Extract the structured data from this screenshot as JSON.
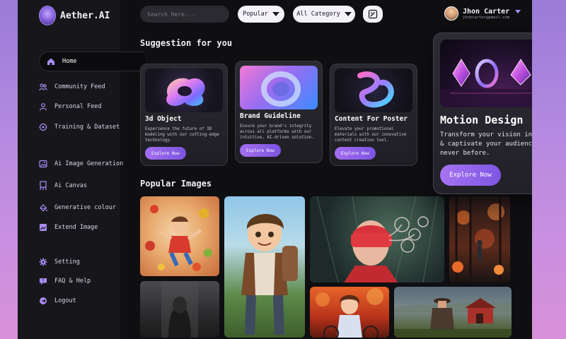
{
  "app": {
    "name": "Aether.AI"
  },
  "search": {
    "placeholder": "Search Here..."
  },
  "filters": {
    "popular_label": "Popular",
    "category_label": "All Category"
  },
  "user": {
    "name": "Jhon Carter",
    "email": "jhoncarter@gmail.com"
  },
  "sidebar": {
    "items": [
      {
        "label": "Home",
        "icon": "home-icon",
        "active": true
      },
      {
        "label": "Community Feed",
        "icon": "users-icon"
      },
      {
        "label": "Personal Feed",
        "icon": "user-icon"
      },
      {
        "label": "Training & Dataset",
        "icon": "training-icon"
      },
      {
        "label": "Ai Image Generation",
        "icon": "image-generation-icon"
      },
      {
        "label": "Ai Canvas",
        "icon": "canvas-icon"
      },
      {
        "label": "Generative colour",
        "icon": "palette-icon"
      },
      {
        "label": "Extend Image",
        "icon": "extend-image-icon"
      },
      {
        "label": "Setting",
        "icon": "gear-icon"
      },
      {
        "label": "FAQ & Help",
        "icon": "help-icon"
      },
      {
        "label": "Logout",
        "icon": "logout-icon"
      }
    ]
  },
  "suggestions": {
    "title": "Suggestion for you",
    "cards": [
      {
        "title": "3d Object",
        "desc": "Experience the future of 3D modeling with our cutting-edge technology.",
        "button": "Explore Now"
      },
      {
        "title": "Brand Guideline",
        "desc": "Ensure your brand's integrity across all platforms with our intuitive, AI-driven solution.",
        "button": "Explore Now"
      },
      {
        "title": "Content For Poster",
        "desc": "Elevate your promotional materials with our innovative content creation tool.",
        "button": "Explore Now"
      }
    ],
    "featured": {
      "title": "Motion Design",
      "desc": "Transform your vision into motion & captivate your audience like never before.",
      "button": "Explore Now"
    }
  },
  "popular": {
    "title": "Popular Images"
  },
  "colors": {
    "accent": "#9b6bef",
    "background": "#0f0f12",
    "sidebar": "#17171b"
  }
}
